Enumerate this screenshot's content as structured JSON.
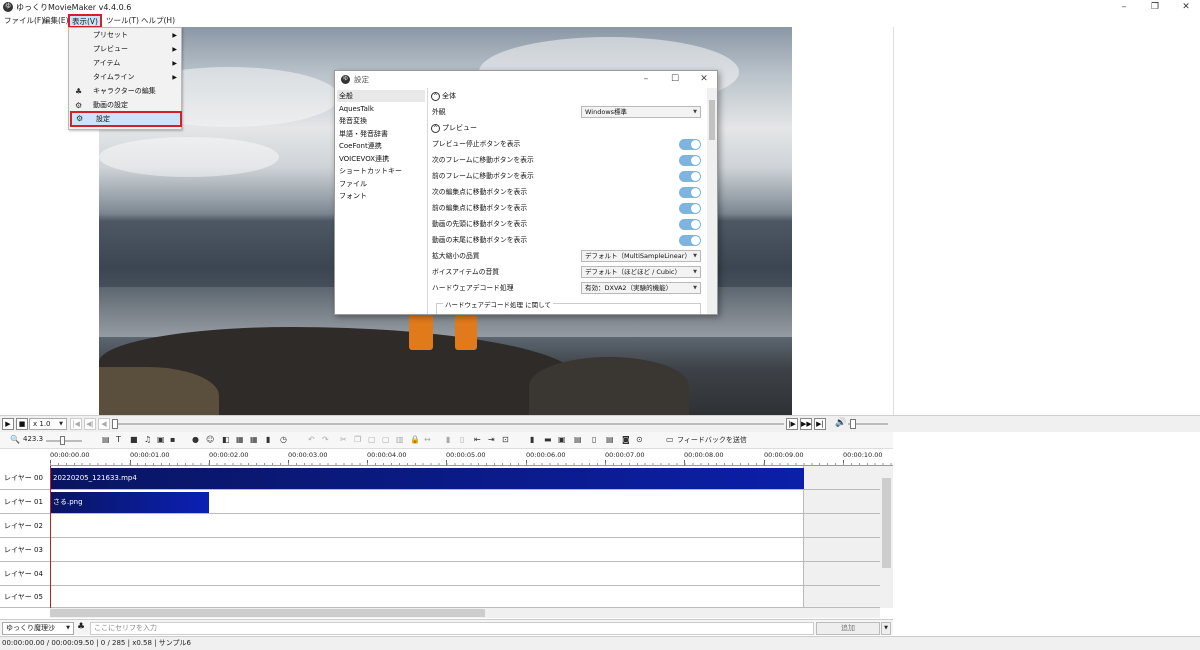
{
  "window": {
    "title": "ゆっくりMovieMaker v4.4.0.6",
    "logo": "ゆ"
  },
  "menubar": {
    "file": "ファイル(F)",
    "edit": "編集(E)",
    "view": "表示(V)",
    "tools": "ツール(T)",
    "help": "ヘルプ(H)"
  },
  "view_menu": {
    "items": [
      "プリセット",
      "プレビュー",
      "アイテム",
      "タイムライン",
      "キャラクターの編集",
      "動画の設定",
      "設定"
    ]
  },
  "settings_dialog": {
    "title": "設定",
    "categories": [
      "全般",
      "AquesTalk",
      "発音変換",
      "単語・発音辞書",
      "CoeFont連携",
      "VOICEVOX連携",
      "ショートカットキー",
      "ファイル",
      "フォント"
    ],
    "section_general": "全体",
    "appearance_label": "外観",
    "appearance_value": "Windows標準",
    "section_preview": "プレビュー",
    "toggles": [
      "プレビュー停止ボタンを表示",
      "次のフレームに移動ボタンを表示",
      "前のフレームに移動ボタンを表示",
      "次の編集点に移動ボタンを表示",
      "前の編集点に移動ボタンを表示",
      "動画の先頭に移動ボタンを表示",
      "動画の末尾に移動ボタンを表示"
    ],
    "scale_quality_label": "拡大縮小の品質",
    "scale_quality_value": "デフォルト（MultiSampleLinear）",
    "voice_quality_label": "ボイスアイテムの音質",
    "voice_quality_value": "デフォルト（ほどほど / Cubic）",
    "hw_decode_label": "ハードウェアデコード処理",
    "hw_decode_value": "有効：DXVA2（実験的機能）",
    "hw_group_label": "ハードウェアデコード処理 に関して"
  },
  "player": {
    "speed": "x 1.0"
  },
  "toolbar": {
    "zoom": "423.3",
    "feedback": "フィードバックを送信"
  },
  "ruler": {
    "ticks": [
      "00:00:00.00",
      "00:00:01.00",
      "00:00:02.00",
      "00:00:03.00",
      "00:00:04.00",
      "00:00:05.00",
      "00:00:06.00",
      "00:00:07.00",
      "00:00:08.00",
      "00:00:09.00",
      "00:00:10.00"
    ]
  },
  "timeline": {
    "layers": [
      "レイヤー 00",
      "レイヤー 01",
      "レイヤー 02",
      "レイヤー 03",
      "レイヤー 04",
      "レイヤー 05"
    ],
    "clips": [
      {
        "layer": 0,
        "name": "20220205_121633.mp4",
        "start_seconds": 0.0,
        "end_seconds": 9.5,
        "color": "#0b1a7a"
      },
      {
        "layer": 1,
        "name": "さる.png",
        "start_seconds": 0.0,
        "end_seconds": 2.0,
        "color": "#0b1a9a"
      }
    ]
  },
  "inputbar": {
    "character": "ゆっくり魔理沙",
    "placeholder": "ここにセリフを入力",
    "add": "追加"
  },
  "status": {
    "text": "00:00:00.00  /  00:00:09.50  |  0  /  285  |  x0.58  |  サンプル6"
  },
  "colors": {
    "highlight_border": "#d3202a",
    "clip_dark": "#0b1a7a",
    "toggle_on": "#7fb3e0"
  }
}
